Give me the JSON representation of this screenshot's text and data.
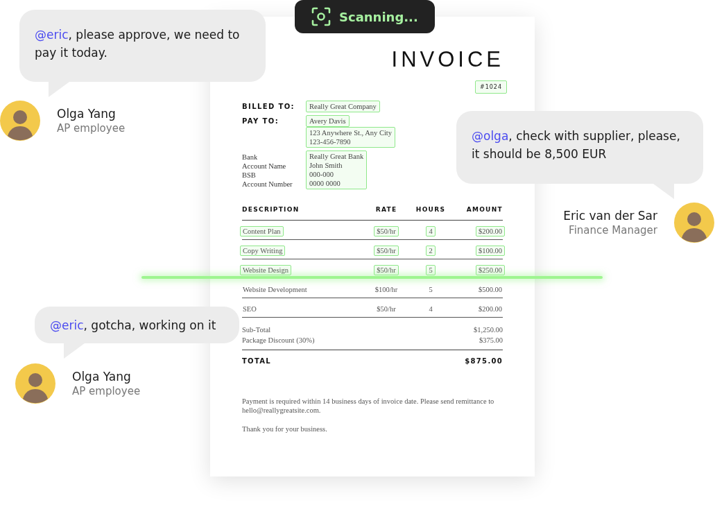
{
  "scan_badge": {
    "label": "Scanning..."
  },
  "invoice": {
    "title": "INVOICE",
    "number": {
      "value": "#1024",
      "detected": true
    },
    "billing": [
      {
        "kind": "heading",
        "label": "BILLED TO:",
        "blocks": [
          {
            "lines": [
              "Really Great Company"
            ],
            "detected": true
          }
        ]
      },
      {
        "kind": "heading",
        "label": "PAY TO:",
        "blocks": [
          {
            "lines": [
              "Avery Davis"
            ],
            "detected": true
          },
          {
            "lines": [
              "123 Anywhere St., Any City",
              "123-456-7890"
            ],
            "detected": true
          }
        ]
      },
      {
        "kind": "plain",
        "labels": [
          "Bank",
          "Account Name",
          "BSB",
          "Account Number"
        ],
        "blocks": [
          {
            "lines": [
              "Really Great Bank",
              "John Smith",
              "000-000",
              "0000 0000"
            ],
            "detected": true
          }
        ]
      }
    ],
    "columns": [
      "DESCRIPTION",
      "RATE",
      "HOURS",
      "AMOUNT"
    ],
    "rows": [
      {
        "description": "Content Plan",
        "rate": "$50/hr",
        "hours": "4",
        "amount": "$200.00",
        "detected": true
      },
      {
        "description": "Copy Writing",
        "rate": "$50/hr",
        "hours": "2",
        "amount": "$100.00",
        "detected": true
      },
      {
        "description": "Website Design",
        "rate": "$50/hr",
        "hours": "5",
        "amount": "$250.00",
        "detected": true
      },
      {
        "description": "Website Development",
        "rate": "$100/hr",
        "hours": "5",
        "amount": "$500.00",
        "detected": false
      },
      {
        "description": "SEO",
        "rate": "$50/hr",
        "hours": "4",
        "amount": "$200.00",
        "detected": false
      }
    ],
    "summary": [
      {
        "label": "Sub-Total",
        "value": "$1,250.00"
      },
      {
        "label": "Package Discount (30%)",
        "value": "$375.00"
      }
    ],
    "total": {
      "label": "TOTAL",
      "value": "$875.00"
    },
    "note": "Payment is required within 14 business days of invoice date. Please send remittance to hello@reallygreatsite.com.",
    "thanks": "Thank you for your business."
  },
  "messages": [
    {
      "mention": "@eric",
      "text": ", please approve, we need to pay it today.",
      "author": "Olga Yang",
      "role": "AP employee"
    },
    {
      "mention": "@olga",
      "text": ", check with supplier, please, it should be 8,500 EUR",
      "author": "Eric van der Sar",
      "role": "Finance Manager"
    },
    {
      "mention": "@eric",
      "text": ", gotcha, working on it",
      "author": "Olga Yang",
      "role": "AP employee"
    }
  ]
}
